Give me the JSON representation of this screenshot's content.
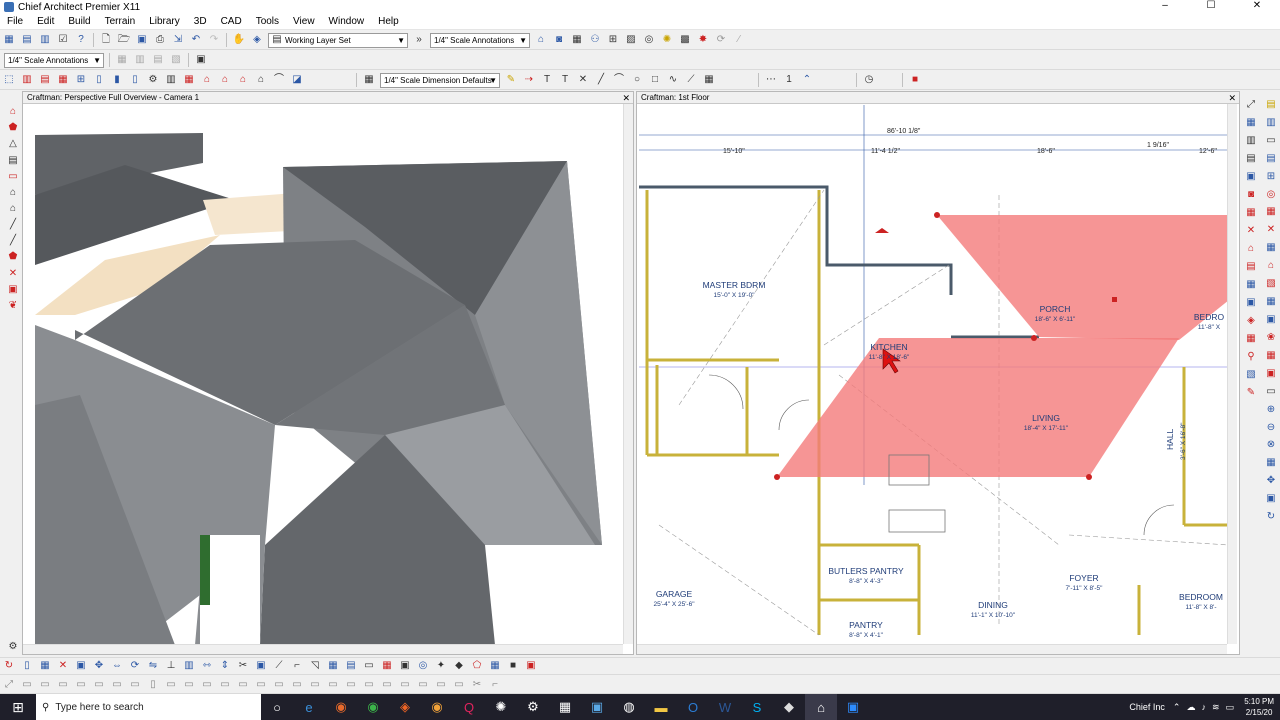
{
  "window": {
    "title": "Chief Architect Premier X11",
    "minimize": "–",
    "maximize": "☐",
    "close": "✕"
  },
  "menu": [
    "File",
    "Edit",
    "Build",
    "Terrain",
    "Library",
    "3D",
    "CAD",
    "Tools",
    "View",
    "Window",
    "Help"
  ],
  "toolbar1": {
    "layer_set": "Working Layer Set",
    "annotation": "1/4\" Scale Annotations"
  },
  "toolbar2": {
    "annotation": "1/4\" Scale Annotations",
    "dimension_defaults": "1/4\" Scale Dimension Defaults",
    "count": "1"
  },
  "left_panel": {
    "title": "Craftman: Perspective Full Overview - Camera 1"
  },
  "right_panel": {
    "title": "Craftman: 1st Floor"
  },
  "plan": {
    "dims_top": [
      "86'-10 1/8\"",
      "15'-10\"",
      "11'-4 1/2\"",
      "18'-6\"",
      "1 9/16\"",
      "12'-6\""
    ],
    "rooms": [
      {
        "name": "MASTER BDRM",
        "size": "15'-0\" X 19'-0\""
      },
      {
        "name": "PORCH",
        "size": "18'-6\" X 6'-11\""
      },
      {
        "name": "KITCHEN",
        "size": "11'-8\" X 18'-6\""
      },
      {
        "name": "LIVING",
        "size": "18'-4\" X 17'-11\""
      },
      {
        "name": "HALL",
        "size": "3'-6\" X 16'-8\""
      },
      {
        "name": "BUTLERS PANTRY",
        "size": "8'-8\" X 4'-3\""
      },
      {
        "name": "PANTRY",
        "size": "8'-8\" X 4'-1\""
      },
      {
        "name": "GARAGE",
        "size": "25'-4\" X 25'-6\""
      },
      {
        "name": "FOYER",
        "size": "7'-11\" X 8'-5\""
      },
      {
        "name": "DINING",
        "size": "11'-1\" X 10'-10\""
      },
      {
        "name": "BEDRO",
        "size": "11'-8\" X"
      },
      {
        "name": "BEDROOM",
        "size": "11'-8\" X 8'-"
      }
    ]
  },
  "taskbar": {
    "search_placeholder": "Type here to search",
    "tray_label": "Chief Inc",
    "time": "5:10 PM",
    "date": "2/15/20"
  },
  "colors": {
    "roof_dark": "#5b5d61",
    "roof_mid": "#808387",
    "roof_light": "#9a9da1",
    "selection_red": "#f47b7b",
    "wall_yellow": "#c8b23a",
    "dim_line": "#2b57a5"
  }
}
